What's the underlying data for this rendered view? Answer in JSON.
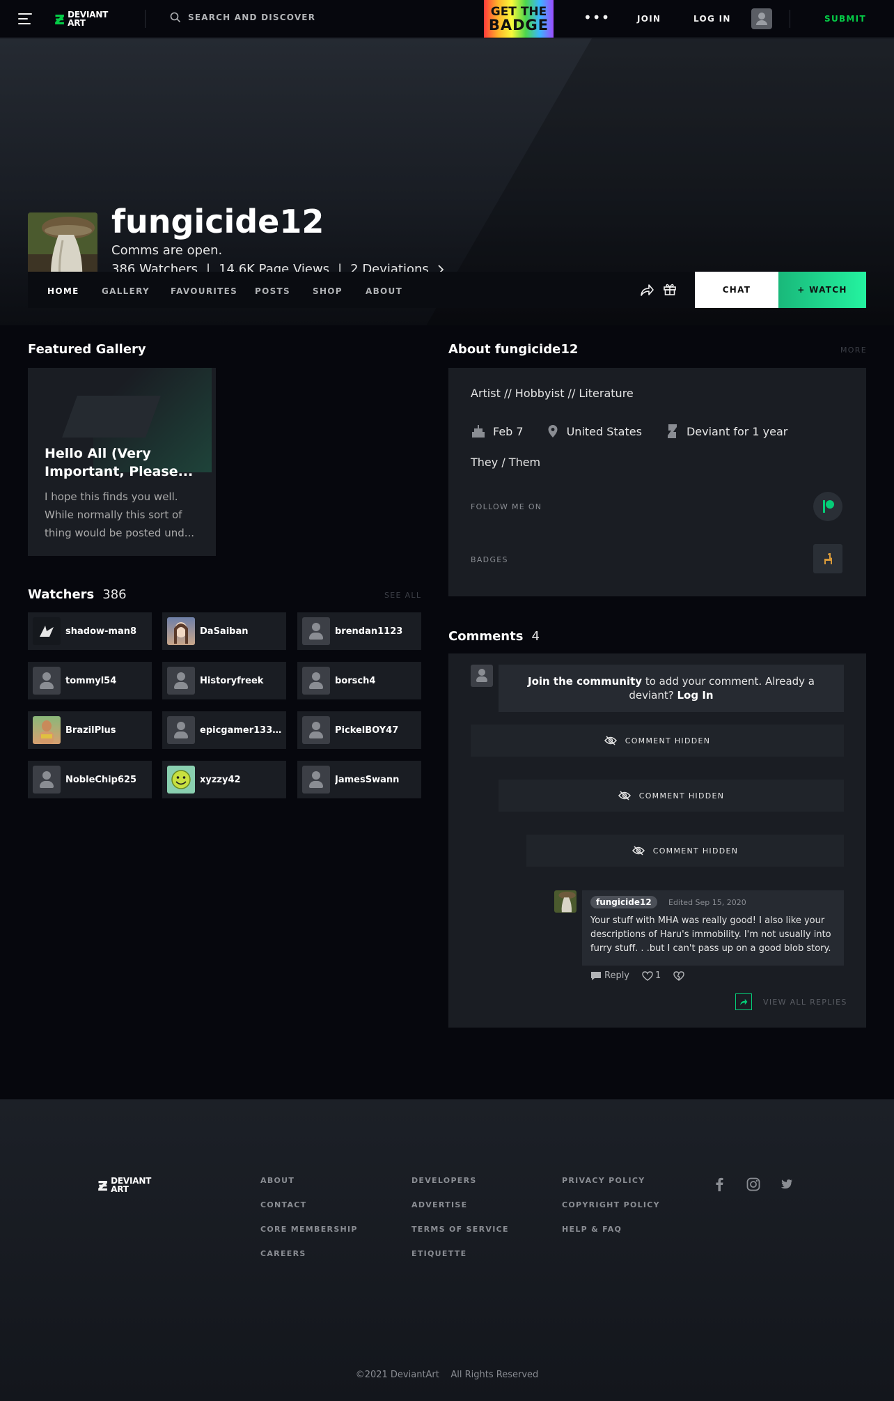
{
  "topbar": {
    "logo_line1": "DEVIANT",
    "logo_line2": "ART",
    "search_placeholder": "SEARCH AND DISCOVER",
    "ad_line1": "GET THE",
    "ad_line2": "BADGE",
    "more": "•••",
    "join": "JOIN",
    "login": "LOG IN",
    "submit": "SUBMIT"
  },
  "profile": {
    "username": "fungicide12",
    "tagline": "Comms are open.",
    "watchers": "386 Watchers",
    "page_views": "14.6K Page Views",
    "deviations": "2 Deviations",
    "separator": "|"
  },
  "profile_nav": {
    "tabs": [
      "HOME",
      "GALLERY",
      "FAVOURITES",
      "POSTS",
      "SHOP",
      "ABOUT"
    ],
    "chat": "CHAT",
    "watch": "+ WATCH"
  },
  "featured": {
    "title": "Featured Gallery",
    "card_title": "Hello All (Very Important, Please...",
    "card_body": "I hope this finds you well. While normally this sort of thing would be posted und..."
  },
  "watchers": {
    "title": "Watchers",
    "count": "386",
    "see_all": "SEE ALL",
    "items": [
      {
        "name": "shadow-man8"
      },
      {
        "name": "DaSaiban"
      },
      {
        "name": "brendan1123"
      },
      {
        "name": "tommyl54"
      },
      {
        "name": "Historyfreek"
      },
      {
        "name": "borsch4"
      },
      {
        "name": "BrazilPlus"
      },
      {
        "name": "epicgamer1337..."
      },
      {
        "name": "PickelBOY47"
      },
      {
        "name": "NobleChip625"
      },
      {
        "name": "xyzzy42"
      },
      {
        "name": "JamesSwann"
      }
    ]
  },
  "about": {
    "title": "About fungicide12",
    "more": "MORE",
    "roles": "Artist  //  Hobbyist  //  Literature",
    "birthday": "Feb 7",
    "location": "United States",
    "tenure": "Deviant for 1 year",
    "pronouns": "They / Them",
    "follow_label": "FOLLOW ME ON",
    "badges_label": "BADGES"
  },
  "comments": {
    "title": "Comments",
    "count": "4",
    "join_bold": "Join the community",
    "join_text": " to add your comment. Already a deviant? ",
    "join_login": "Log In",
    "hidden_label": "COMMENT HIDDEN",
    "reply_author": "fungicide12",
    "reply_edited": "Edited Sep 15, 2020",
    "reply_text": "Your stuff with MHA was really good! I also like your descriptions of Haru's immobility. I'm not usually into furry stuff. . .but I can't pass up on a good blob story.",
    "reply_label": "Reply",
    "likes": "1",
    "view_all": "VIEW ALL REPLIES"
  },
  "footer": {
    "col1": [
      "ABOUT",
      "CONTACT",
      "CORE MEMBERSHIP",
      "CAREERS"
    ],
    "col2": [
      "DEVELOPERS",
      "ADVERTISE",
      "TERMS OF SERVICE",
      "ETIQUETTE"
    ],
    "col3": [
      "PRIVACY POLICY",
      "COPYRIGHT POLICY",
      "HELP & FAQ"
    ],
    "copyright": "©2021 DeviantArt    All Rights Reserved"
  },
  "colors": {
    "accent": "#05cc47",
    "watch_gradient_end": "#24f3a0",
    "panel": "#1a1d23",
    "background": "#06070d"
  }
}
